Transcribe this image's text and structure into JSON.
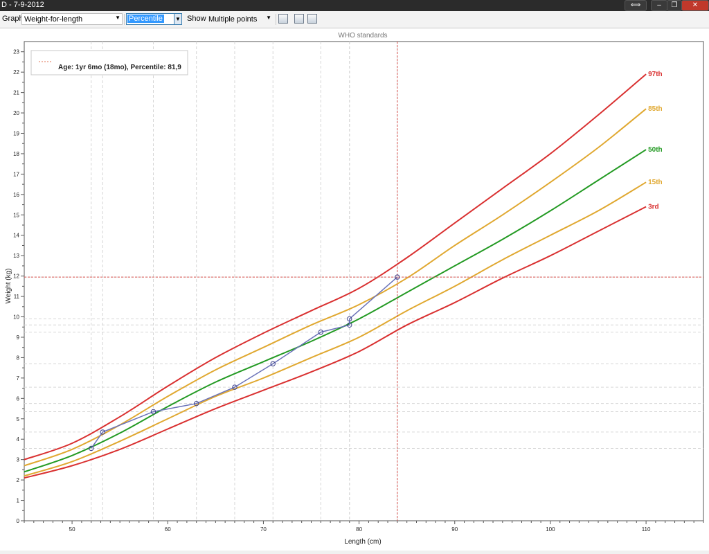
{
  "window": {
    "title": "D - 7-9-2012"
  },
  "toolbar": {
    "graph_label": "Graph",
    "graph_value": "Weight-for-length",
    "mode_value": "Percentile",
    "show_label": "Show",
    "show_value": "Multiple points"
  },
  "chart_data": {
    "type": "line",
    "title": "WHO standards",
    "xlabel": "Length (cm)",
    "ylabel": "Weight (kg)",
    "xlim": [
      45,
      116
    ],
    "ylim": [
      0,
      23.5
    ],
    "xticks": [
      50,
      60,
      70,
      80,
      90,
      100,
      110
    ],
    "yticks": [
      0,
      1,
      2,
      3,
      4,
      5,
      6,
      7,
      8,
      9,
      10,
      11,
      12,
      13,
      14,
      15,
      16,
      17,
      18,
      19,
      20,
      21,
      22,
      23
    ],
    "grid": true,
    "legend": {
      "position": "top-left",
      "text": "Age: 1yr 6mo (18mo), Percentile: 81,9",
      "marker_color": "#e07050"
    },
    "crosshair": {
      "x": 84,
      "y": 11.95,
      "color": "#d9534f"
    },
    "series": [
      {
        "name": "97th",
        "color": "#d93030",
        "x": [
          45,
          50,
          55,
          60,
          65,
          70,
          75,
          80,
          85,
          90,
          95,
          100,
          105,
          110
        ],
        "y": [
          3.0,
          3.8,
          5.1,
          6.6,
          8.0,
          9.2,
          10.3,
          11.4,
          12.9,
          14.6,
          16.3,
          18.0,
          19.9,
          21.9
        ]
      },
      {
        "name": "85th",
        "color": "#e0a830",
        "x": [
          45,
          50,
          55,
          60,
          65,
          70,
          75,
          80,
          85,
          90,
          95,
          100,
          105,
          110
        ],
        "y": [
          2.7,
          3.5,
          4.7,
          6.1,
          7.4,
          8.5,
          9.6,
          10.6,
          11.9,
          13.5,
          15.0,
          16.6,
          18.3,
          20.2
        ]
      },
      {
        "name": "50th",
        "color": "#239a23",
        "x": [
          45,
          50,
          55,
          60,
          65,
          70,
          75,
          80,
          85,
          90,
          95,
          100,
          105,
          110
        ],
        "y": [
          2.4,
          3.2,
          4.3,
          5.6,
          6.8,
          7.8,
          8.8,
          9.9,
          11.2,
          12.5,
          13.8,
          15.2,
          16.7,
          18.2
        ]
      },
      {
        "name": "15th",
        "color": "#e0a830",
        "x": [
          45,
          50,
          55,
          60,
          65,
          70,
          75,
          80,
          85,
          90,
          95,
          100,
          105,
          110
        ],
        "y": [
          2.2,
          2.9,
          3.9,
          5.0,
          6.1,
          7.0,
          8.0,
          9.0,
          10.3,
          11.5,
          12.8,
          14.0,
          15.2,
          16.6
        ]
      },
      {
        "name": "3rd",
        "color": "#d93030",
        "x": [
          45,
          50,
          55,
          60,
          65,
          70,
          75,
          80,
          85,
          90,
          95,
          100,
          105,
          110
        ],
        "y": [
          2.1,
          2.7,
          3.5,
          4.5,
          5.5,
          6.4,
          7.3,
          8.3,
          9.6,
          10.7,
          11.9,
          13.0,
          14.2,
          15.4
        ]
      }
    ],
    "measurements": {
      "color": "#6a72b8",
      "x": [
        52,
        53.2,
        58.5,
        63,
        67,
        71,
        76,
        79,
        79,
        84
      ],
      "y": [
        3.55,
        4.35,
        5.35,
        5.75,
        6.55,
        7.7,
        9.25,
        9.6,
        9.9,
        11.95
      ]
    }
  }
}
